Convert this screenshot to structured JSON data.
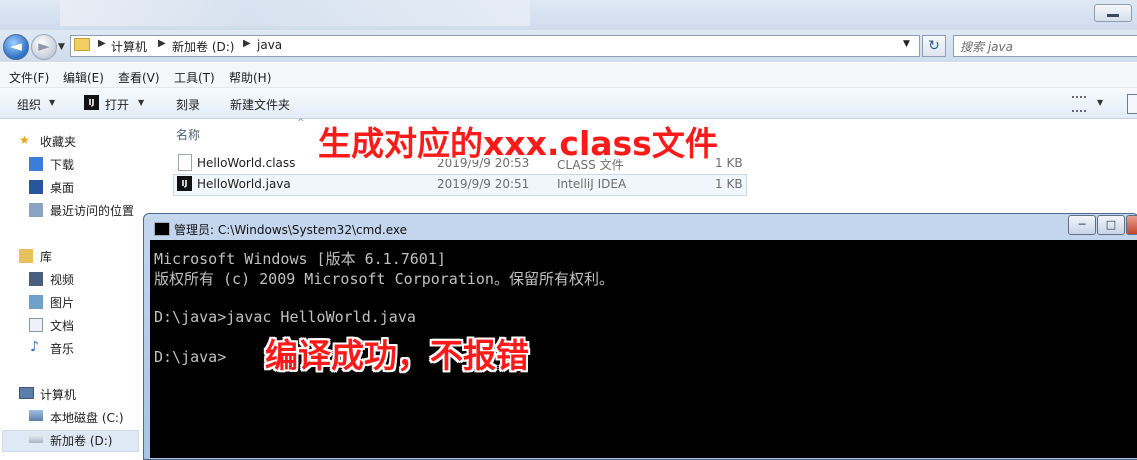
{
  "navigation": {
    "back_glyph": "◄",
    "forward_glyph": "►",
    "breadcrumb": [
      "计算机",
      "新加卷 (D:)",
      "java"
    ],
    "search_placeholder": "搜索 java"
  },
  "menu": [
    "文件(F)",
    "编辑(E)",
    "查看(V)",
    "工具(T)",
    "帮助(H)"
  ],
  "toolbar": {
    "organize": "组织",
    "open": "打开",
    "burn": "刻录",
    "new_folder": "新建文件夹",
    "ij_badge": "IJ"
  },
  "sidebar": {
    "favorites": {
      "header": "收藏夹",
      "items": [
        "下载",
        "桌面",
        "最近访问的位置"
      ]
    },
    "libraries": {
      "header": "库",
      "items": [
        "视频",
        "图片",
        "文档",
        "音乐"
      ]
    },
    "computer": {
      "header": "计算机",
      "items": [
        "本地磁盘 (C:)",
        "新加卷 (D:)"
      ]
    }
  },
  "file_list": {
    "column_name": "名称",
    "files": [
      {
        "name": "HelloWorld.class",
        "date": "2019/9/9 20:53",
        "type": "CLASS 文件",
        "size": "1 KB",
        "icon": "class-file-icon"
      },
      {
        "name": "HelloWorld.java",
        "date": "2019/9/9 20:51",
        "type": "IntelliJ IDEA",
        "size": "1 KB",
        "icon": "intellij-icon"
      }
    ]
  },
  "annotations": {
    "top": "生成对应的xxx.class文件",
    "bottom": "编译成功，不报错"
  },
  "cmd": {
    "title": "管理员: C:\\Windows\\System32\\cmd.exe",
    "lines": [
      "Microsoft Windows [版本 6.1.7601]",
      "版权所有 (c) 2009 Microsoft Corporation。保留所有权利。",
      "",
      "D:\\java>javac HelloWorld.java",
      "",
      "D:\\java>"
    ],
    "buttons": {
      "minimize": "─",
      "maximize": "□",
      "close": "X"
    }
  },
  "colors": {
    "annotation_red": "#ff1a1a",
    "console_bg": "#000000",
    "console_text": "#c0c0c0"
  }
}
